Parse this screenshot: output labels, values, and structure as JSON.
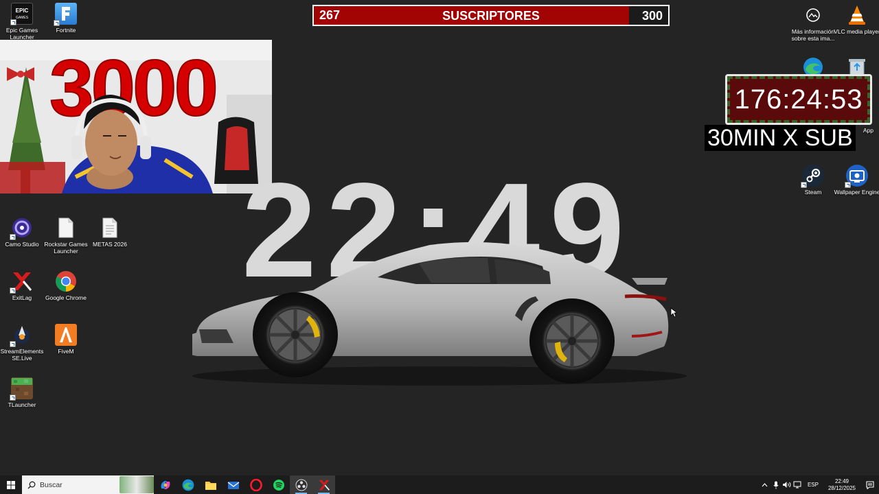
{
  "desktop_icons": [
    {
      "label": "Epic Games Launcher",
      "icon": "epic-games-icon"
    },
    {
      "label": "Fortnite",
      "icon": "fortnite-icon"
    },
    {
      "label": "Camo Studio",
      "icon": "camo-studio-icon"
    },
    {
      "label": "Rockstar Games Launcher",
      "icon": "file-icon"
    },
    {
      "label": "METAS 2026",
      "icon": "file-icon"
    },
    {
      "label": "ExitLag",
      "icon": "exitlag-icon"
    },
    {
      "label": "Google Chrome",
      "icon": "chrome-icon"
    },
    {
      "label": "StreamElements SE.Live",
      "icon": "streamelements-icon"
    },
    {
      "label": "FiveM",
      "icon": "fivem-icon"
    },
    {
      "label": "TLauncher",
      "icon": "tlauncher-icon"
    },
    {
      "label": "Más información sobre esta ima...",
      "icon": "info-icon"
    },
    {
      "label": "VLC media player",
      "icon": "vlc-icon"
    },
    {
      "label": "App",
      "icon": "app-icon"
    },
    {
      "label": "Steam",
      "icon": "steam-icon"
    },
    {
      "label": "Wallpaper Engine",
      "icon": "wallpaper-engine-icon"
    }
  ],
  "sub_goal": {
    "current": "267",
    "title": "SUSCRIPTORES",
    "goal": "300",
    "progress_fraction": 0.89,
    "fill_color": "#a20303"
  },
  "webcam": {
    "balloon_text": "3000"
  },
  "wallpaper_clock": "22:49",
  "countdown": {
    "time": "176:24:53",
    "caption": "30MIN X SUB"
  },
  "taskbar": {
    "search_placeholder": "Buscar",
    "apps": [
      "copilot-icon",
      "edge-icon",
      "file-explorer-icon",
      "mail-icon",
      "opera-icon",
      "spotify-icon",
      "obs-icon",
      "exitlag-icon"
    ],
    "language": "ESP",
    "time": "22:49",
    "date": "28/12/2025"
  },
  "colors": {
    "accent_red": "#a20303",
    "taskbar": "#1c1c1c",
    "desktop_bg": "#242424"
  }
}
